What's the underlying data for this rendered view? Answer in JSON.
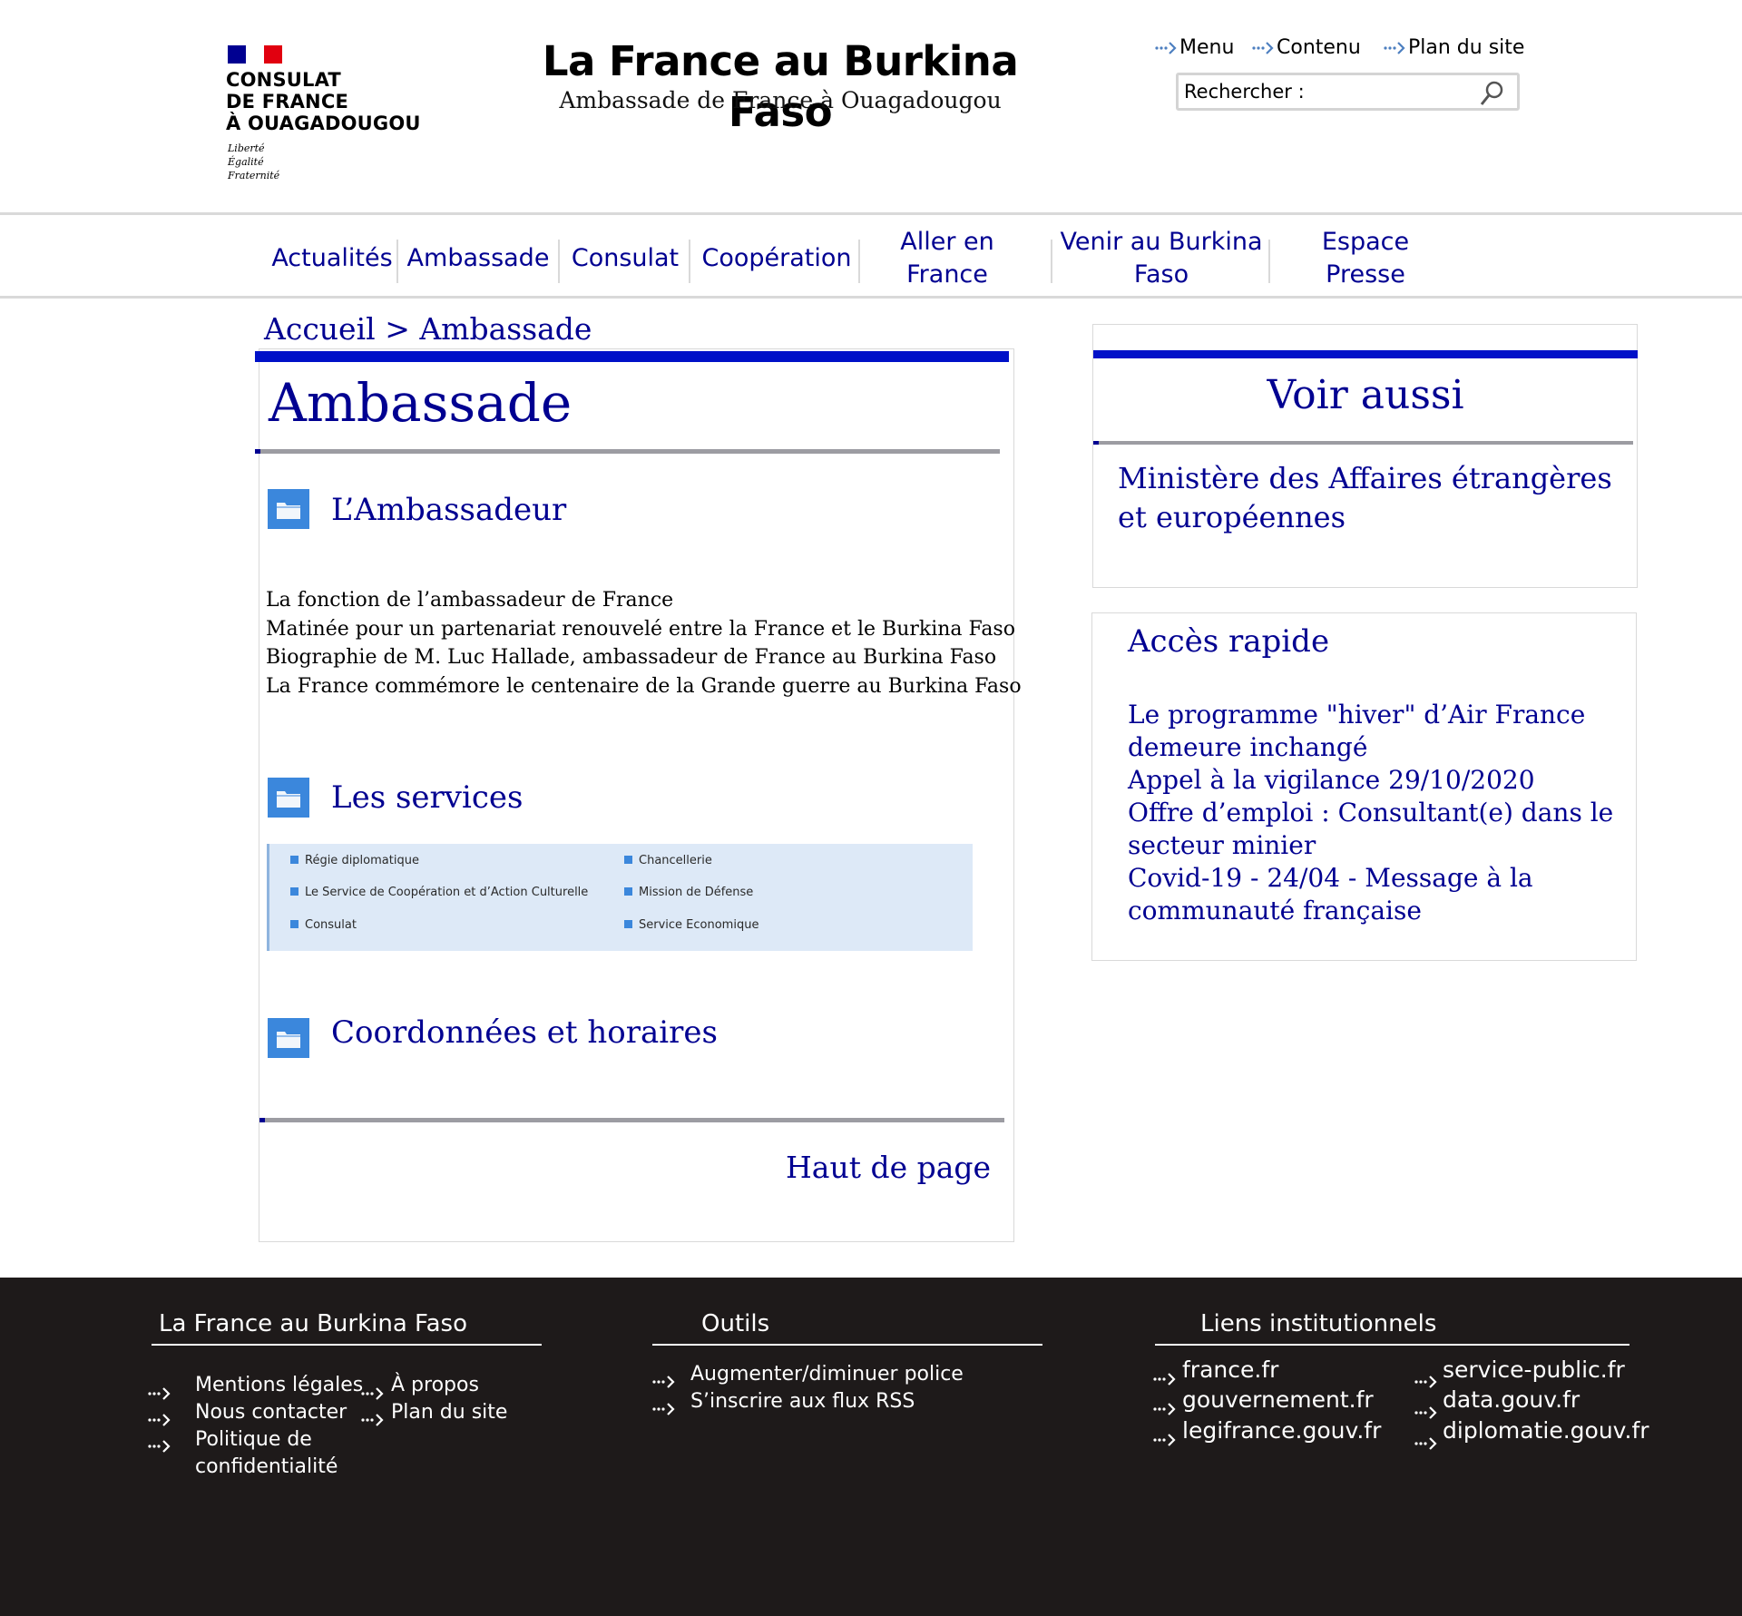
{
  "header": {
    "logo_lines": [
      "CONSULAT",
      "DE FRANCE",
      "À OUAGADOUGOU"
    ],
    "logo_devise": [
      "Liberté",
      "Égalité",
      "Fraternité"
    ],
    "site_title": "La France au Burkina Faso",
    "site_subtitle": "Ambassade de France à Ouagadougou",
    "top_links": [
      "Menu",
      "Contenu",
      "Plan du site"
    ],
    "search_placeholder": "Rechercher :",
    "flag_colors": [
      "#000091",
      "#ffffff",
      "#e1000f"
    ]
  },
  "nav": {
    "items": [
      "Actualités",
      "Ambassade",
      "Consulat",
      "Coopération",
      "Aller en France",
      "Venir au Burkina Faso",
      "Espace Presse"
    ]
  },
  "breadcrumb": {
    "home": "Accueil",
    "separator": ">",
    "current": "Ambassade"
  },
  "main": {
    "title": "Ambassade",
    "sections": [
      {
        "title": "L’Ambassadeur",
        "icon": "folder-icon",
        "items": [
          "La fonction de l’ambassadeur de France",
          "Matinée pour un partenariat renouvelé entre la France et le Burkina Faso",
          "Biographie de M. Luc Hallade, ambassadeur de France au Burkina Faso",
          "La France commémore le centenaire de la Grande guerre au Burkina Faso"
        ]
      },
      {
        "title": "Les services",
        "icon": "folder-icon",
        "items": [
          "Régie diplomatique",
          "Chancellerie",
          "Le Service de Coopération et d’Action Culturelle",
          "Mission de Défense",
          "Consulat",
          "Service Economique"
        ]
      },
      {
        "title": "Coordonnées et horaires",
        "icon": "folder-icon"
      }
    ],
    "back_to_top": "Haut de page"
  },
  "sidebar": {
    "voir_aussi": {
      "title": "Voir aussi",
      "link": "Ministère des Affaires étrangères et européennes"
    },
    "acces_rapide": {
      "title": "Accès rapide",
      "items": [
        "Le programme \"hiver\" d’Air France demeure inchangé",
        "Appel à la vigilance 29/10/2020",
        "Offre d’emploi : Consultant(e) dans le secteur minier",
        "Covid-19 - 24/04 - Message à la communauté française"
      ]
    }
  },
  "footer": {
    "col1": {
      "title": "La France au Burkina Faso",
      "links": [
        "Mentions légales",
        "Nous contacter",
        "Politique de confidentialité",
        "À propos",
        "Plan du site"
      ]
    },
    "col2": {
      "title": "Outils",
      "links": [
        "Augmenter/diminuer police",
        "S’inscrire aux flux RSS"
      ]
    },
    "col3": {
      "title": "Liens institutionnels",
      "links": [
        "france.fr",
        "gouvernement.fr",
        "legifrance.gouv.fr",
        "service-public.fr",
        "data.gouv.fr",
        "diplomatie.gouv.fr"
      ]
    }
  },
  "colors": {
    "link_blue": "#000091",
    "accent_bar": "#0011c8",
    "icon_blue": "#3b87dc",
    "services_bg": "#dde9f7",
    "footer_bg": "#1e1a1a"
  }
}
